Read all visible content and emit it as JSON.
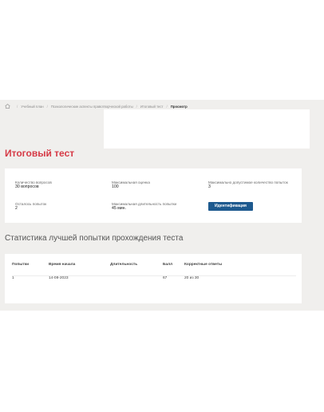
{
  "breadcrumb": {
    "items": [
      "Учебный план",
      "Психологические аспекты правотворческой работы",
      "Итоговый тест"
    ],
    "current": "Просмотр"
  },
  "page": {
    "title": "Итоговый тест"
  },
  "test_info": {
    "questions_label": "Количество вопросов",
    "questions_value": "30 вопросов",
    "max_score_label": "Максимальная оценка",
    "max_score_value": "100",
    "max_attempts_label": "Максимально допустимое количество попыток",
    "max_attempts_value": "3",
    "attempts_left_label": "Осталось попыток",
    "attempts_left_value": "2",
    "max_duration_label": "Максимальная длительность попытки",
    "max_duration_value": "45 мин.",
    "identify_button": "Идентификация"
  },
  "stats": {
    "title": "Статистика лучшей попытки прохождения теста",
    "columns": [
      "Попытки",
      "Время начала",
      "Длительность",
      "Балл",
      "Корректные ответы"
    ],
    "rows": [
      [
        "1",
        "14-08-2023",
        "",
        "67",
        "20 из 30"
      ]
    ]
  },
  "colors": {
    "accent": "#d63a46",
    "button": "#1e5a8f",
    "background": "#f0efed"
  }
}
